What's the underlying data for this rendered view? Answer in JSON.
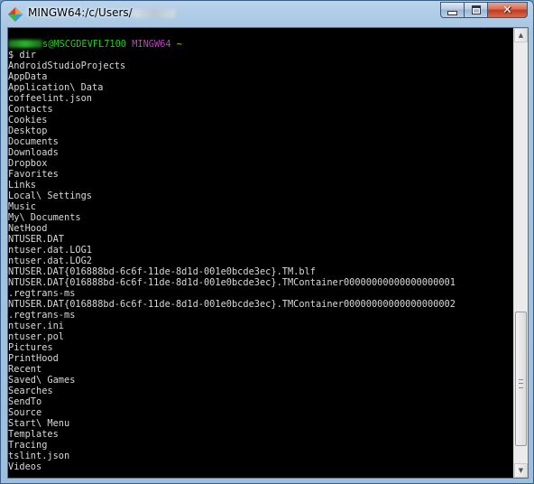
{
  "window": {
    "title": "MINGW64:/c/Users/"
  },
  "prompt": {
    "user_host": "s@MSCGDEVFL7100",
    "system": "MINGW64",
    "path": "~",
    "symbol": "$",
    "command": "dir"
  },
  "output": [
    "AndroidStudioProjects",
    "AppData",
    "Application\\ Data",
    "coffeelint.json",
    "Contacts",
    "Cookies",
    "Desktop",
    "Documents",
    "Downloads",
    "Dropbox",
    "Favorites",
    "Links",
    "Local\\ Settings",
    "Music",
    "My\\ Documents",
    "NetHood",
    "NTUSER.DAT",
    "ntuser.dat.LOG1",
    "ntuser.dat.LOG2",
    "NTUSER.DAT{016888bd-6c6f-11de-8d1d-001e0bcde3ec}.TM.blf",
    "NTUSER.DAT{016888bd-6c6f-11de-8d1d-001e0bcde3ec}.TMContainer00000000000000000001",
    ".regtrans-ms",
    "NTUSER.DAT{016888bd-6c6f-11de-8d1d-001e0bcde3ec}.TMContainer00000000000000000002",
    ".regtrans-ms",
    "ntuser.ini",
    "ntuser.pol",
    "Pictures",
    "PrintHood",
    "Recent",
    "Saved\\ Games",
    "Searches",
    "SendTo",
    "Source",
    "Start\\ Menu",
    "Templates",
    "Tracing",
    "tslint.json",
    "Videos"
  ],
  "icons": {
    "app": "mingw-diamond-icon",
    "minimize": "minimize-icon",
    "maximize": "maximize-icon",
    "close": "close-icon",
    "scroll_up": "scroll-up-arrow-icon",
    "scroll_down": "scroll-down-arrow-icon"
  },
  "colors": {
    "prompt_user": "#1fd01f",
    "prompt_system": "#c040c0",
    "prompt_path": "#c0c000",
    "text": "#d9d9d9",
    "background": "#000000"
  },
  "scroll": {
    "thumb_position": 0.64,
    "thumb_size": 0.32
  }
}
